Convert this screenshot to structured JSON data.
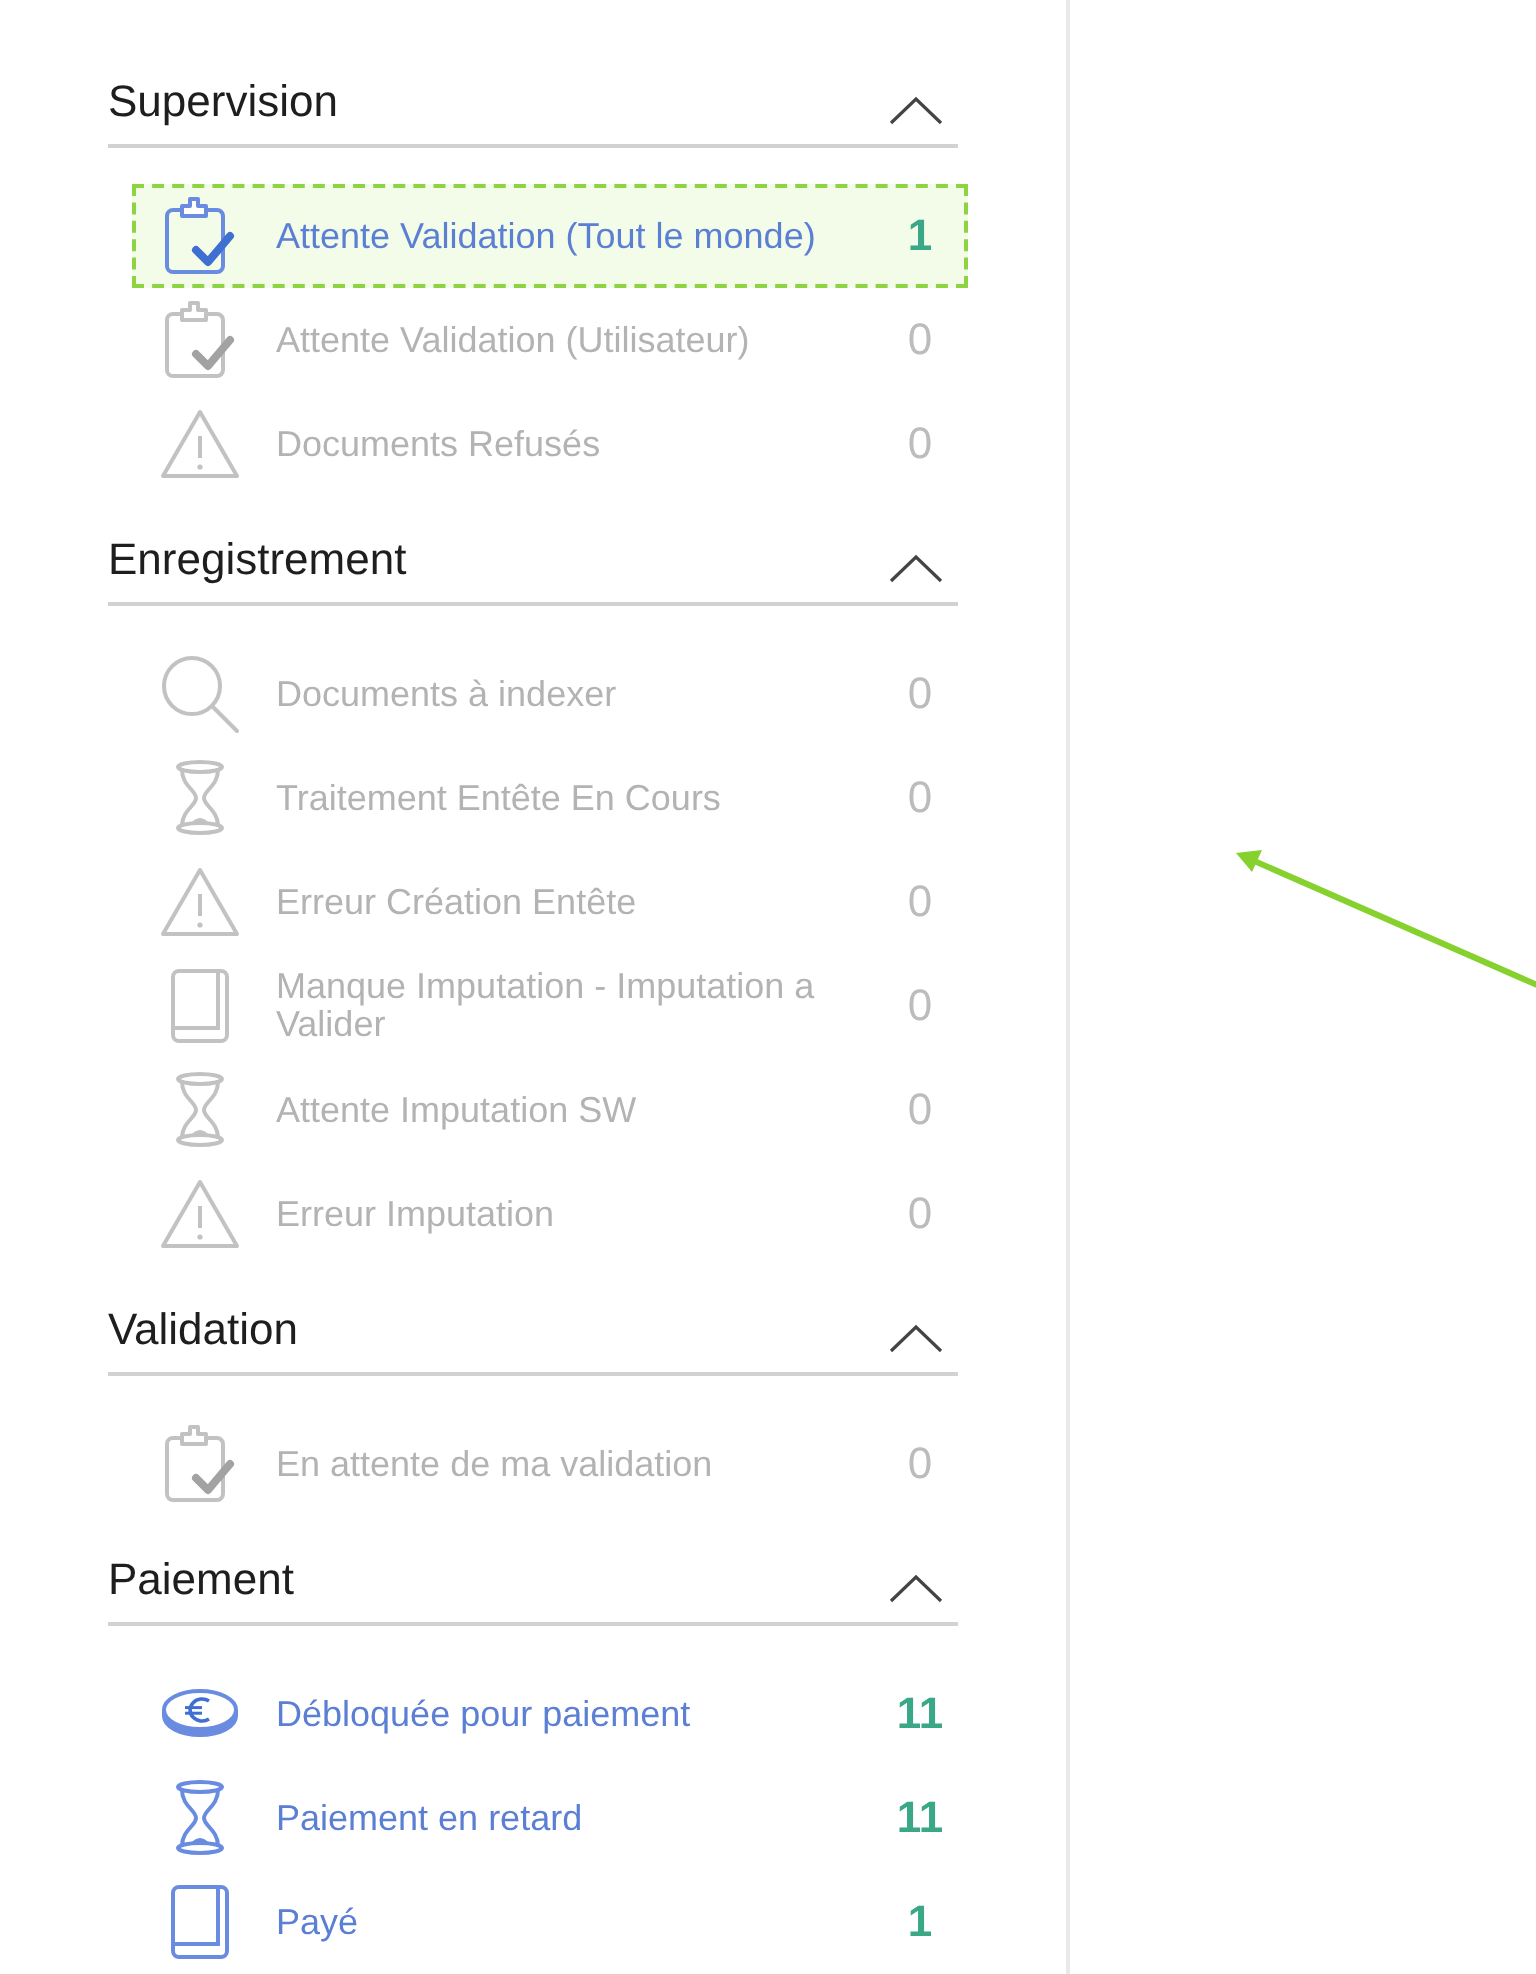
{
  "sections": [
    {
      "title": "Supervision",
      "expanded": true,
      "items": [
        {
          "kind": "clipboard",
          "label": "Attente Validation (Tout le monde)",
          "count": "1",
          "disabled": false,
          "highlighted": true
        },
        {
          "kind": "clipboard",
          "label": "Attente Validation (Utilisateur)",
          "count": "0",
          "disabled": true,
          "highlighted": false
        },
        {
          "kind": "warning",
          "label": "Documents Refusés",
          "count": "0",
          "disabled": true,
          "highlighted": false
        }
      ]
    },
    {
      "title": "Enregistrement",
      "expanded": true,
      "items": [
        {
          "kind": "search",
          "label": "Documents à indexer",
          "count": "0",
          "disabled": true,
          "highlighted": false
        },
        {
          "kind": "hourglass",
          "label": "Traitement Entête En Cours",
          "count": "0",
          "disabled": true,
          "highlighted": false
        },
        {
          "kind": "warning",
          "label": "Erreur Création Entête",
          "count": "0",
          "disabled": true,
          "highlighted": false
        },
        {
          "kind": "book",
          "label": "Manque Imputation - Imputation a Valider",
          "count": "0",
          "disabled": true,
          "highlighted": false
        },
        {
          "kind": "hourglass",
          "label": "Attente Imputation SW",
          "count": "0",
          "disabled": true,
          "highlighted": false
        },
        {
          "kind": "warning",
          "label": "Erreur Imputation",
          "count": "0",
          "disabled": true,
          "highlighted": false
        }
      ]
    },
    {
      "title": "Validation",
      "expanded": true,
      "items": [
        {
          "kind": "clipboard",
          "label": "En attente de ma validation",
          "count": "0",
          "disabled": true,
          "highlighted": false
        }
      ]
    },
    {
      "title": "Paiement",
      "expanded": true,
      "items": [
        {
          "kind": "coin",
          "label": "Débloquée pour paiement",
          "count": "11",
          "disabled": false,
          "highlighted": false
        },
        {
          "kind": "hourglass",
          "label": "Paiement en retard",
          "count": "11",
          "disabled": false,
          "highlighted": false
        },
        {
          "kind": "book",
          "label": "Payé",
          "count": "1",
          "disabled": false,
          "highlighted": false
        }
      ]
    }
  ]
}
